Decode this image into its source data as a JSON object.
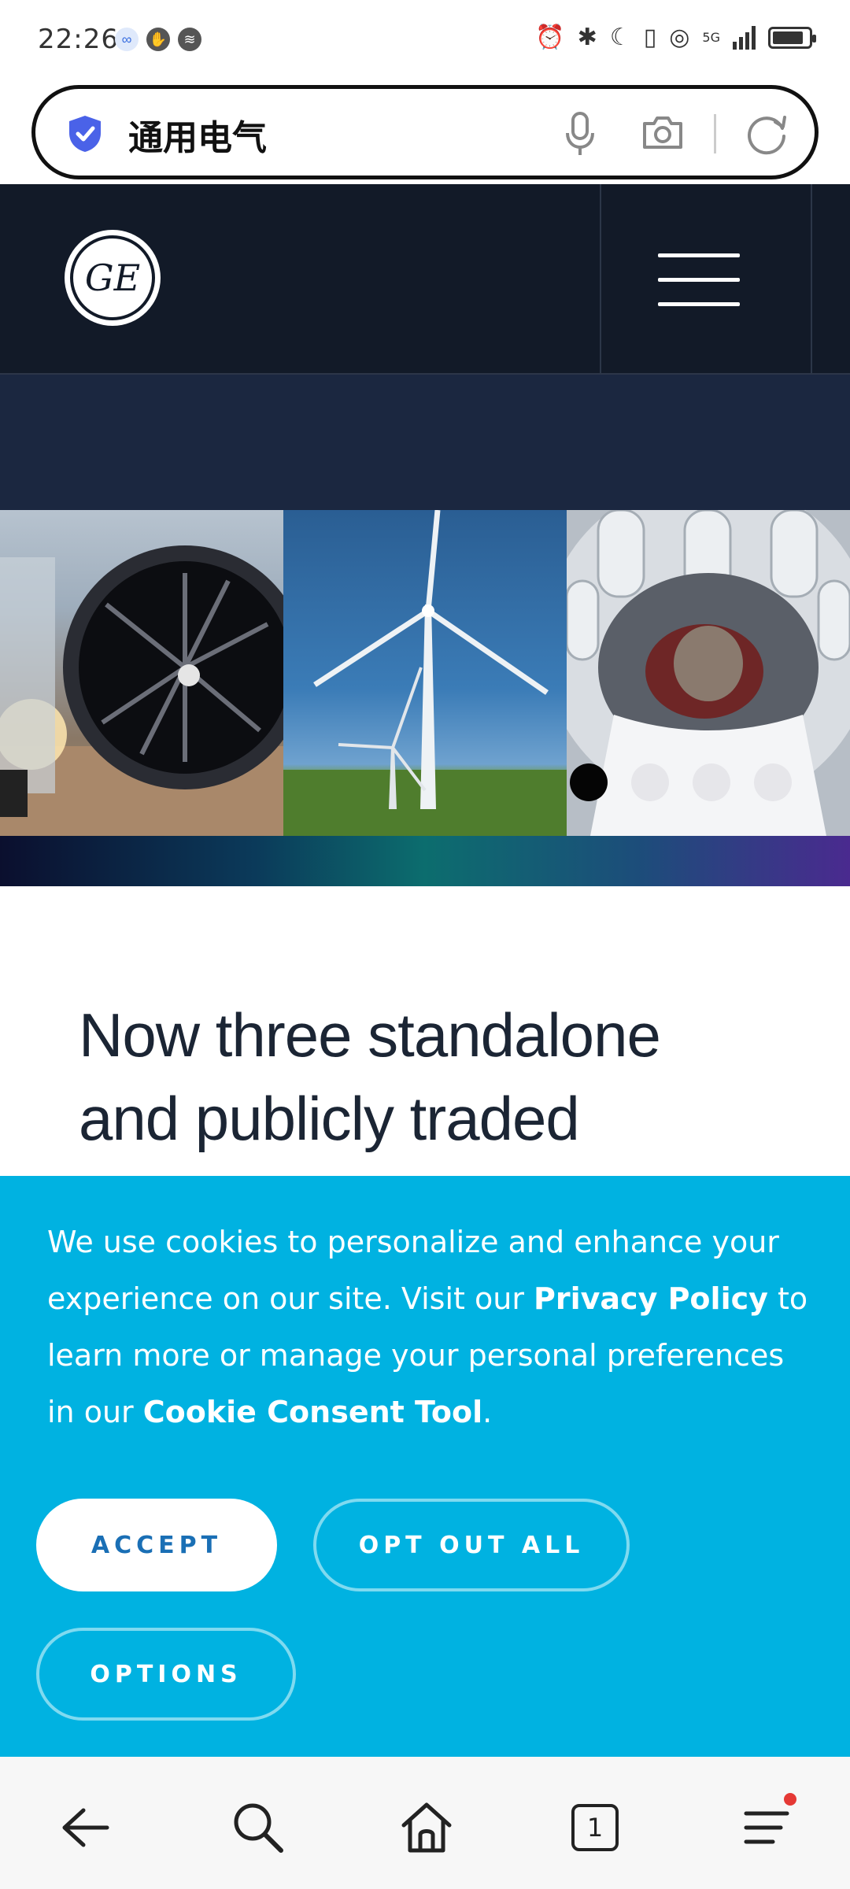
{
  "status_bar": {
    "time": "22:26",
    "network": "5G"
  },
  "search": {
    "query": "通用电气"
  },
  "site": {
    "logo_text": "GE"
  },
  "carousel": {
    "slide_count": 4,
    "active_index": 0
  },
  "headline": {
    "line1": "Now three standalone",
    "line2": "and publicly traded"
  },
  "cookie": {
    "text_1": "We use cookies to personalize and enhance your experience on our site. Visit our ",
    "privacy_link": "Privacy Policy",
    "text_2": " to learn more or manage your personal preferences in our ",
    "consent_link": "Cookie Consent Tool",
    "text_3": ".",
    "accept_label": "ACCEPT",
    "optout_label": "OPT OUT ALL",
    "options_label": "OPTIONS"
  },
  "bottom_nav": {
    "tab_count": "1"
  },
  "colors": {
    "header_bg": "#121a28",
    "cookie_bg": "#00b2e1",
    "accent_text": "#1a6fb5"
  }
}
